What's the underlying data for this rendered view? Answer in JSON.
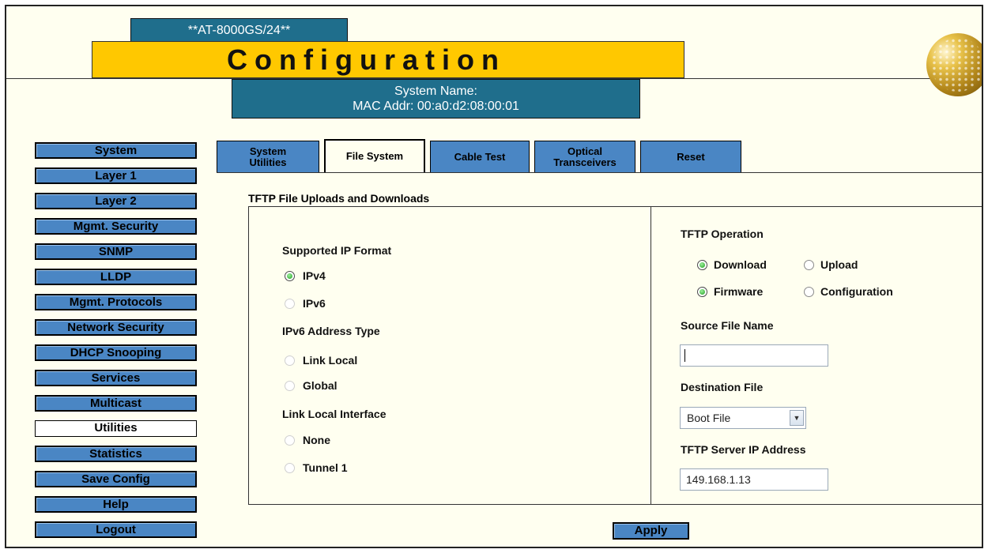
{
  "header": {
    "model": "**AT-8000GS/24**",
    "title": "Configuration",
    "system_name_label": "System Name:",
    "mac_addr_line": "MAC Addr:  00:a0:d2:08:00:01"
  },
  "sidebar": {
    "items": [
      {
        "label": "System"
      },
      {
        "label": "Layer 1"
      },
      {
        "label": "Layer 2"
      },
      {
        "label": "Mgmt. Security"
      },
      {
        "label": "SNMP"
      },
      {
        "label": "LLDP"
      },
      {
        "label": "Mgmt. Protocols"
      },
      {
        "label": "Network Security"
      },
      {
        "label": "DHCP Snooping"
      },
      {
        "label": "Services"
      },
      {
        "label": "Multicast"
      },
      {
        "label": "Utilities",
        "active": true
      },
      {
        "label": "Statistics"
      },
      {
        "label": "Save Config"
      },
      {
        "label": "Help"
      },
      {
        "label": "Logout"
      }
    ]
  },
  "tabs": [
    {
      "label": "System\nUtilities"
    },
    {
      "label": "File System",
      "active": true
    },
    {
      "label": "Cable Test"
    },
    {
      "label": "Optical\nTransceivers"
    },
    {
      "label": "Reset"
    }
  ],
  "section_title": "TFTP File Uploads and Downloads",
  "left_panel": {
    "ip_format_label": "Supported IP Format",
    "ipv4": "IPv4",
    "ipv6": "IPv6",
    "ipv6_type_label": "IPv6 Address Type",
    "link_local": "Link Local",
    "global": "Global",
    "link_local_iface_label": "Link Local Interface",
    "none": "None",
    "tunnel1": "Tunnel 1"
  },
  "right_panel": {
    "operation_label": "TFTP Operation",
    "download": "Download",
    "upload": "Upload",
    "firmware": "Firmware",
    "configuration": "Configuration",
    "source_file_label": "Source File Name",
    "source_file_value": "",
    "destination_label": "Destination File",
    "destination_value": "Boot File",
    "server_ip_label": "TFTP Server IP Address",
    "server_ip_value": "149.168.1.13"
  },
  "apply_label": "Apply",
  "colors": {
    "accent_blue": "#1f6e8c",
    "button_blue": "#4a86c4",
    "title_yellow": "#ffc800",
    "page_bg": "#fffff0"
  }
}
